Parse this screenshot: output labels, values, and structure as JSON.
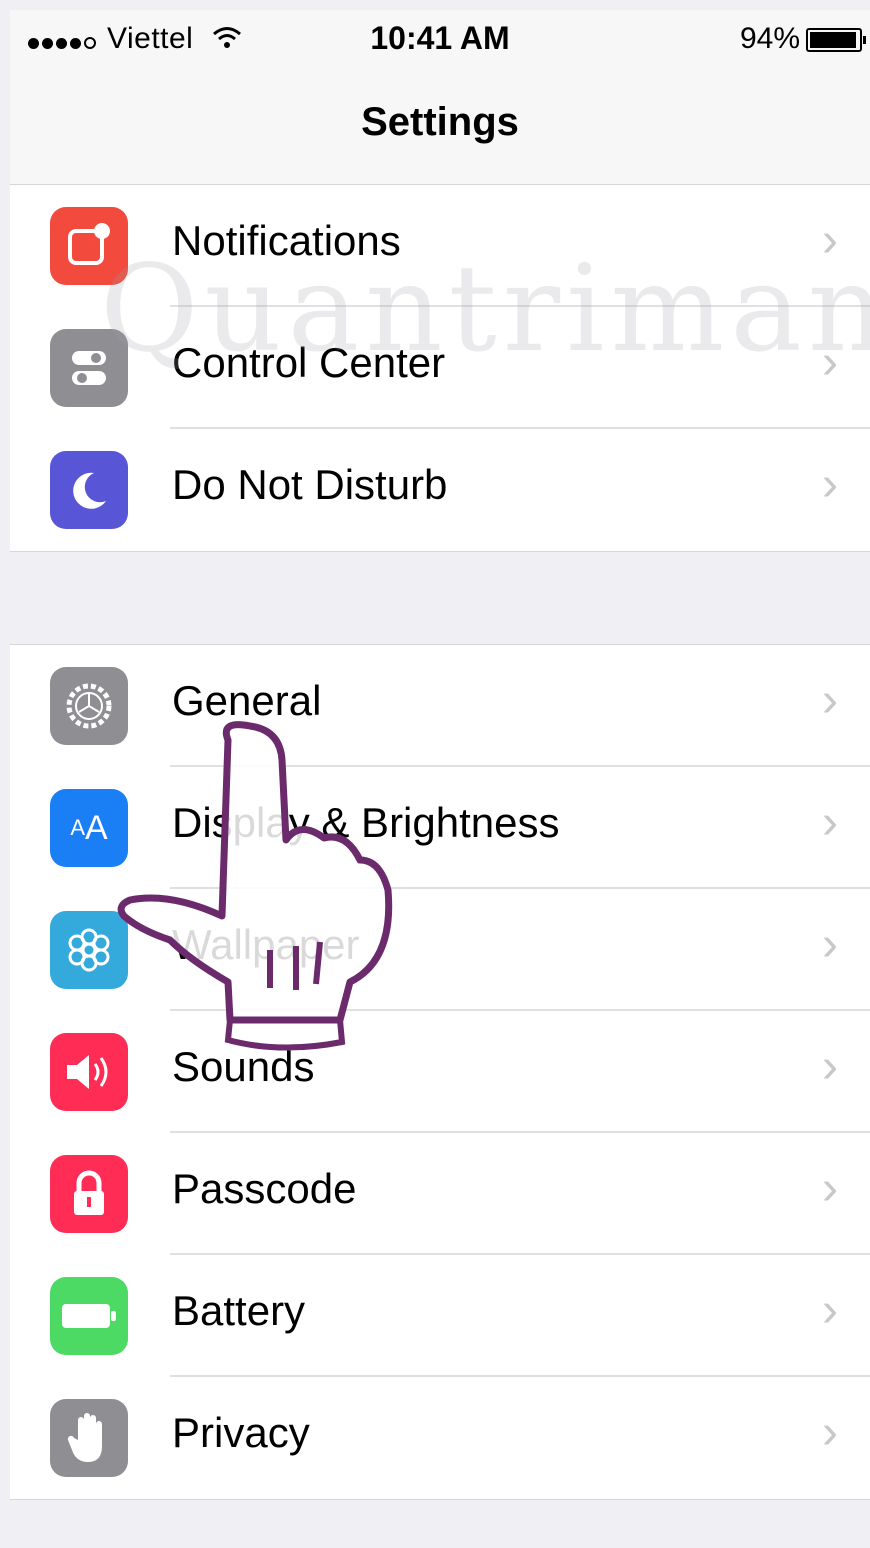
{
  "status_bar": {
    "carrier": "Viettel",
    "time": "10:41 AM",
    "battery_percent": "94%"
  },
  "nav": {
    "title": "Settings"
  },
  "groups": [
    {
      "items": [
        {
          "label": "Notifications",
          "color": "#f24a3c",
          "icon": "notifications-icon"
        },
        {
          "label": "Control Center",
          "color": "#8e8e93",
          "icon": "control-center-icon"
        },
        {
          "label": "Do Not Disturb",
          "color": "#5856d6",
          "icon": "moon-icon"
        }
      ]
    },
    {
      "items": [
        {
          "label": "General",
          "color": "#8e8e93",
          "icon": "gear-icon"
        },
        {
          "label": "Display & Brightness",
          "color": "#1a7ff5",
          "icon": "text-size-icon"
        },
        {
          "label": "Wallpaper",
          "color": "#34aadc",
          "icon": "wallpaper-icon"
        },
        {
          "label": "Sounds",
          "color": "#ff2d55",
          "icon": "speaker-icon"
        },
        {
          "label": "Passcode",
          "color": "#ff2d55",
          "icon": "lock-icon"
        },
        {
          "label": "Battery",
          "color": "#4cd964",
          "icon": "battery-icon"
        },
        {
          "label": "Privacy",
          "color": "#8e8e93",
          "icon": "hand-icon"
        }
      ]
    }
  ],
  "chevron": "›"
}
